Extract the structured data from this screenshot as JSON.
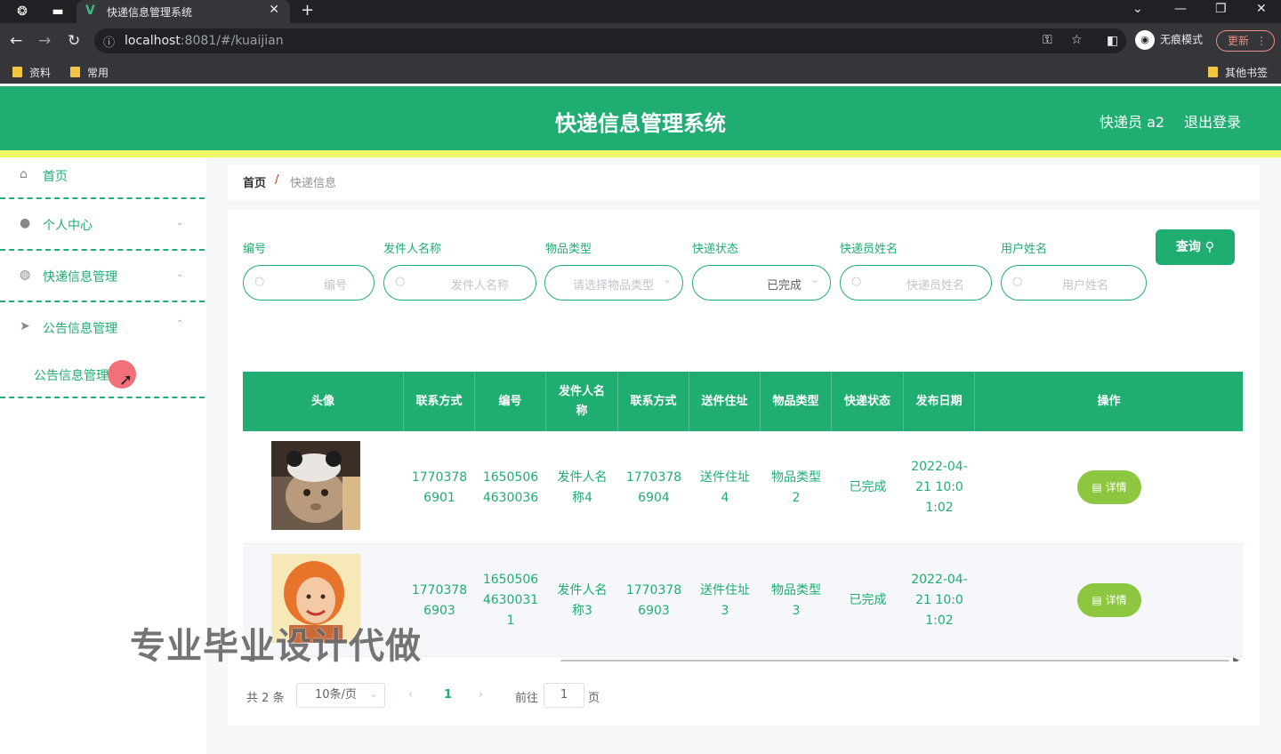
{
  "browser": {
    "tab_title": "快递信息管理系统",
    "url_host": "localhost",
    "url_rest": ":8081/#/kuaijian",
    "incognito_label": "无痕模式",
    "update_label": "更新",
    "bookmarks": [
      "资料",
      "常用"
    ],
    "other_bookmarks": "其他书签"
  },
  "header": {
    "title": "快递信息管理系统",
    "user": "快递员 a2",
    "logout": "退出登录"
  },
  "sidebar": {
    "items": [
      {
        "label": "首页",
        "icon": "home-icon"
      },
      {
        "label": "个人中心",
        "icon": "user-icon"
      },
      {
        "label": "快递信息管理",
        "icon": "globe-icon"
      },
      {
        "label": "公告信息管理",
        "icon": "send-icon"
      }
    ],
    "submenu": "公告信息管理"
  },
  "breadcrumb": {
    "home": "首页",
    "sep": "/",
    "current": "快递信息"
  },
  "filters": [
    {
      "label": "编号",
      "placeholder": "编号"
    },
    {
      "label": "发件人名称",
      "placeholder": "发件人名称"
    },
    {
      "label": "物品类型",
      "placeholder": "请选择物品类型"
    },
    {
      "label": "快递状态",
      "placeholder": "已完成"
    },
    {
      "label": "快递员姓名",
      "placeholder": "快递员姓名"
    },
    {
      "label": "用户姓名",
      "placeholder": "用户姓名"
    }
  ],
  "query_label": "查询",
  "table": {
    "headers": [
      "头像",
      "联系方式",
      "编号",
      "发件人名称",
      "联系方式",
      "送件住址",
      "物品类型",
      "快递状态",
      "发布日期",
      "操作"
    ],
    "rows": [
      [
        "",
        "17703786901",
        "16505064630036",
        "发件人名称4",
        "17703786904",
        "送件住址4",
        "物品类型2",
        "已完成",
        "2022-04-21 10:01:02",
        "详情"
      ],
      [
        "",
        "17703786903",
        "165050646300311",
        "发件人名称3",
        "17703786903",
        "送件住址3",
        "物品类型3",
        "已完成",
        "2022-04-21 10:01:02",
        "详情"
      ]
    ]
  },
  "pagination": {
    "total": "共 2 条",
    "page_size": "10条/页",
    "current": "1",
    "goto": "前往",
    "goto_value": "1",
    "unit": "页"
  },
  "watermark": "专业毕业设计代做",
  "colors": {
    "primary": "#20ad72",
    "accent_line": "#f4f763",
    "detail_btn": "#8dc63f"
  }
}
